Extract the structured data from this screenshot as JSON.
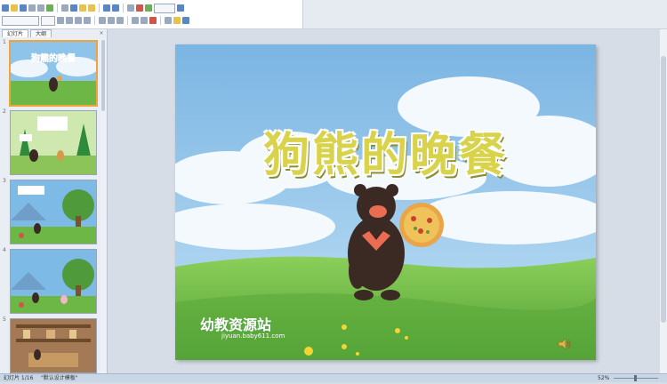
{
  "toolbar": {
    "row1_buttons": [
      "new-icon",
      "open-icon",
      "save-icon",
      "print-icon",
      "preview-icon",
      "spell-icon",
      "cut-icon",
      "copy-icon",
      "paste-icon",
      "format-painter-icon",
      "undo-icon",
      "redo-icon",
      "insert-table-icon",
      "insert-chart-icon",
      "insert-picture-icon",
      "zoom-icon",
      "help-icon"
    ],
    "row2_buttons": [
      "bold-icon",
      "italic-icon",
      "underline-icon",
      "shadow-icon",
      "align-left-icon",
      "align-center-icon",
      "align-right-icon",
      "numbering-icon",
      "bullets-icon",
      "font-color-icon",
      "layout-icon",
      "design-icon"
    ]
  },
  "left_panel": {
    "tabs": [
      {
        "label": "幻灯片",
        "active": true
      },
      {
        "label": "大纲",
        "active": false
      }
    ],
    "close_glyph": "×",
    "thumbnails": [
      {
        "number": "1",
        "selected": true
      },
      {
        "number": "2",
        "selected": false
      },
      {
        "number": "3",
        "selected": false
      },
      {
        "number": "4",
        "selected": false
      },
      {
        "number": "5",
        "selected": false
      }
    ]
  },
  "slide": {
    "title": "狗熊的晚餐",
    "watermark": "幼教资源站",
    "watermark_url": "jiyuan.baby611.com"
  },
  "statusbar": {
    "slide_indicator": "幻灯片 1/16",
    "theme": "\"默认设计模板\"",
    "zoom": "52%"
  },
  "colors": {
    "title_fill": "#d8d34a",
    "grass": "#6db746",
    "sky": "#8fc4ea",
    "selected_thumb_border": "#f2a43a"
  }
}
